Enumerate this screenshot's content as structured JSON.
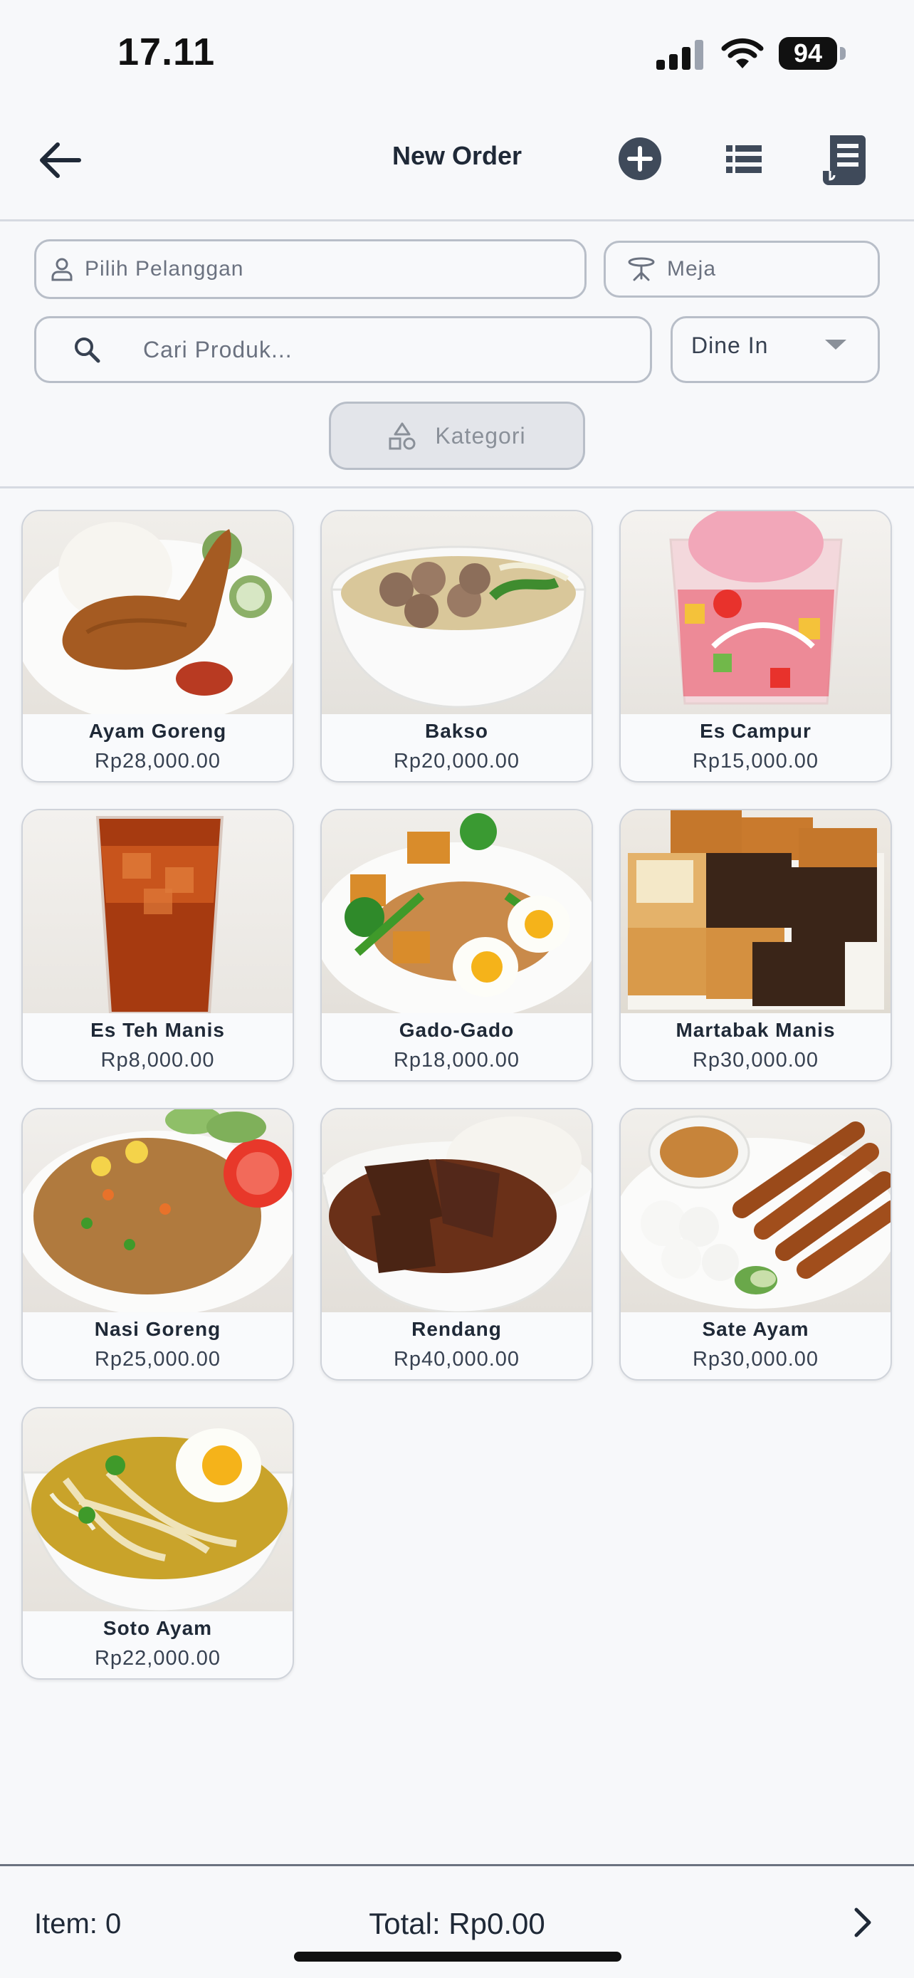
{
  "status_bar": {
    "time": "17.11",
    "battery": "94"
  },
  "header": {
    "title": "New Order"
  },
  "filters": {
    "customer_placeholder": "Pilih Pelanggan",
    "table_placeholder": "Meja",
    "search_placeholder": "Cari Produk...",
    "order_type": "Dine In",
    "category_label": "Kategori"
  },
  "products": [
    {
      "name": "Ayam Goreng",
      "price": "Rp28,000.00"
    },
    {
      "name": "Bakso",
      "price": "Rp20,000.00"
    },
    {
      "name": "Es Campur",
      "price": "Rp15,000.00"
    },
    {
      "name": "Es Teh Manis",
      "price": "Rp8,000.00"
    },
    {
      "name": "Gado-Gado",
      "price": "Rp18,000.00"
    },
    {
      "name": "Martabak Manis",
      "price": "Rp30,000.00"
    },
    {
      "name": "Nasi Goreng",
      "price": "Rp25,000.00"
    },
    {
      "name": "Rendang",
      "price": "Rp40,000.00"
    },
    {
      "name": "Sate Ayam",
      "price": "Rp30,000.00"
    },
    {
      "name": "Soto Ayam",
      "price": "Rp22,000.00"
    }
  ],
  "footer": {
    "item_count": "Item: 0",
    "total": "Total: Rp0.00"
  },
  "colors": {
    "accent": "#3f4a5a",
    "background": "#f7f8fa",
    "border": "#b8bec8"
  }
}
